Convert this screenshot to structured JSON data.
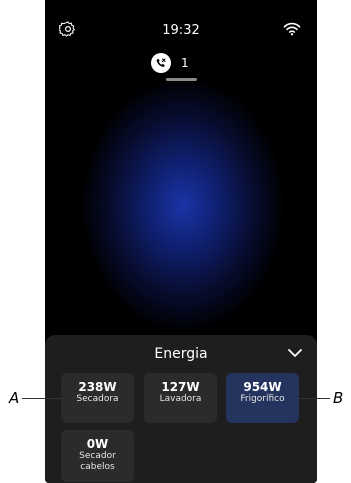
{
  "status": {
    "time": "19:32",
    "missed_calls": "1"
  },
  "panel": {
    "title": "Energia",
    "tiles": [
      {
        "value": "238W",
        "name": "Secadora"
      },
      {
        "value": "127W",
        "name": "Lavadora"
      },
      {
        "value": "954W",
        "name": "Frigorífico"
      },
      {
        "value": "0W",
        "name": "Secador cabelos"
      }
    ]
  },
  "callouts": {
    "left": "A",
    "right": "B"
  },
  "colors": {
    "tile": "#2b2b2b",
    "tile_active": "#24345f",
    "panel": "#1e1e1e",
    "glow": "#1a34a8"
  }
}
